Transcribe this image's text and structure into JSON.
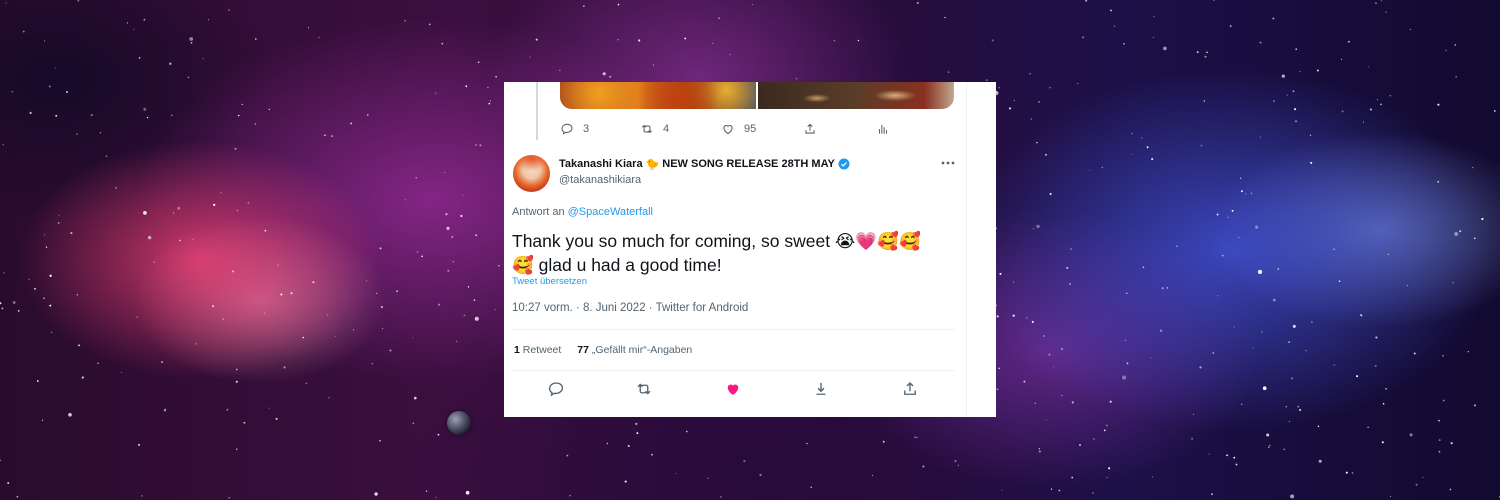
{
  "background": {
    "scene": "space-nebula"
  },
  "quoted_tweet": {
    "replies": "3",
    "retweets": "4",
    "likes": "95"
  },
  "tweet": {
    "display_name": "Takanashi Kiara",
    "name_emoji": "🐤",
    "name_suffix": "NEW SONG RELEASE 28TH MAY",
    "handle": "@takanashikiara",
    "reply_to_prefix": "Antwort an ",
    "reply_to_user": "@SpaceWaterfall",
    "text_line1": "Thank you so much for coming,  so sweet 😭💗🥰🥰",
    "text_line2": "🥰 glad u had a good time!",
    "translate_label": "Tweet übersetzen",
    "meta": "10:27 vorm. · 8. Juni 2022 · Twitter for Android",
    "retweet_count": "1",
    "retweet_label": "Retweet",
    "like_count": "77",
    "like_label": "„Gefällt mir“-Angaben"
  },
  "colors": {
    "accent": "#1d9bf0",
    "like": "#f91880",
    "text": "#0f1419",
    "secondary": "#536471"
  }
}
